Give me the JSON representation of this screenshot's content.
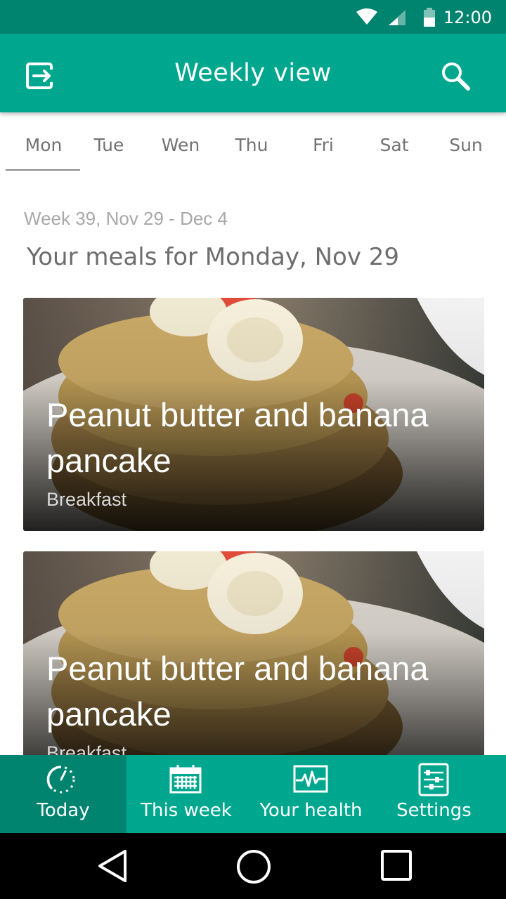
{
  "status_bar": {
    "time": "12:00"
  },
  "app_bar": {
    "title": "Weekly view"
  },
  "day_tabs": [
    "Mon",
    "Tue",
    "Wen",
    "Thu",
    "Fri",
    "Sat",
    "Sun"
  ],
  "selected_day_index": 0,
  "week_label": "Week 39, Nov 29 - Dec 4",
  "meals_heading": "Your meals for Monday, Nov 29",
  "meals": [
    {
      "title": "Peanut butter and banana pancake",
      "type": "Breakfast"
    },
    {
      "title": "Peanut butter and banana pancake",
      "type": "Breakfast"
    }
  ],
  "bottom_nav": [
    {
      "label": "Today",
      "icon": "clock-dashed-icon"
    },
    {
      "label": "This week",
      "icon": "calendar-icon"
    },
    {
      "label": "Your health",
      "icon": "heart-rate-icon"
    },
    {
      "label": "Settings",
      "icon": "settings-sliders-icon"
    }
  ],
  "bottom_nav_active_index": 0,
  "colors": {
    "primary": "#00a78f",
    "primary_dark": "#00846f",
    "text_muted": "#727272"
  }
}
